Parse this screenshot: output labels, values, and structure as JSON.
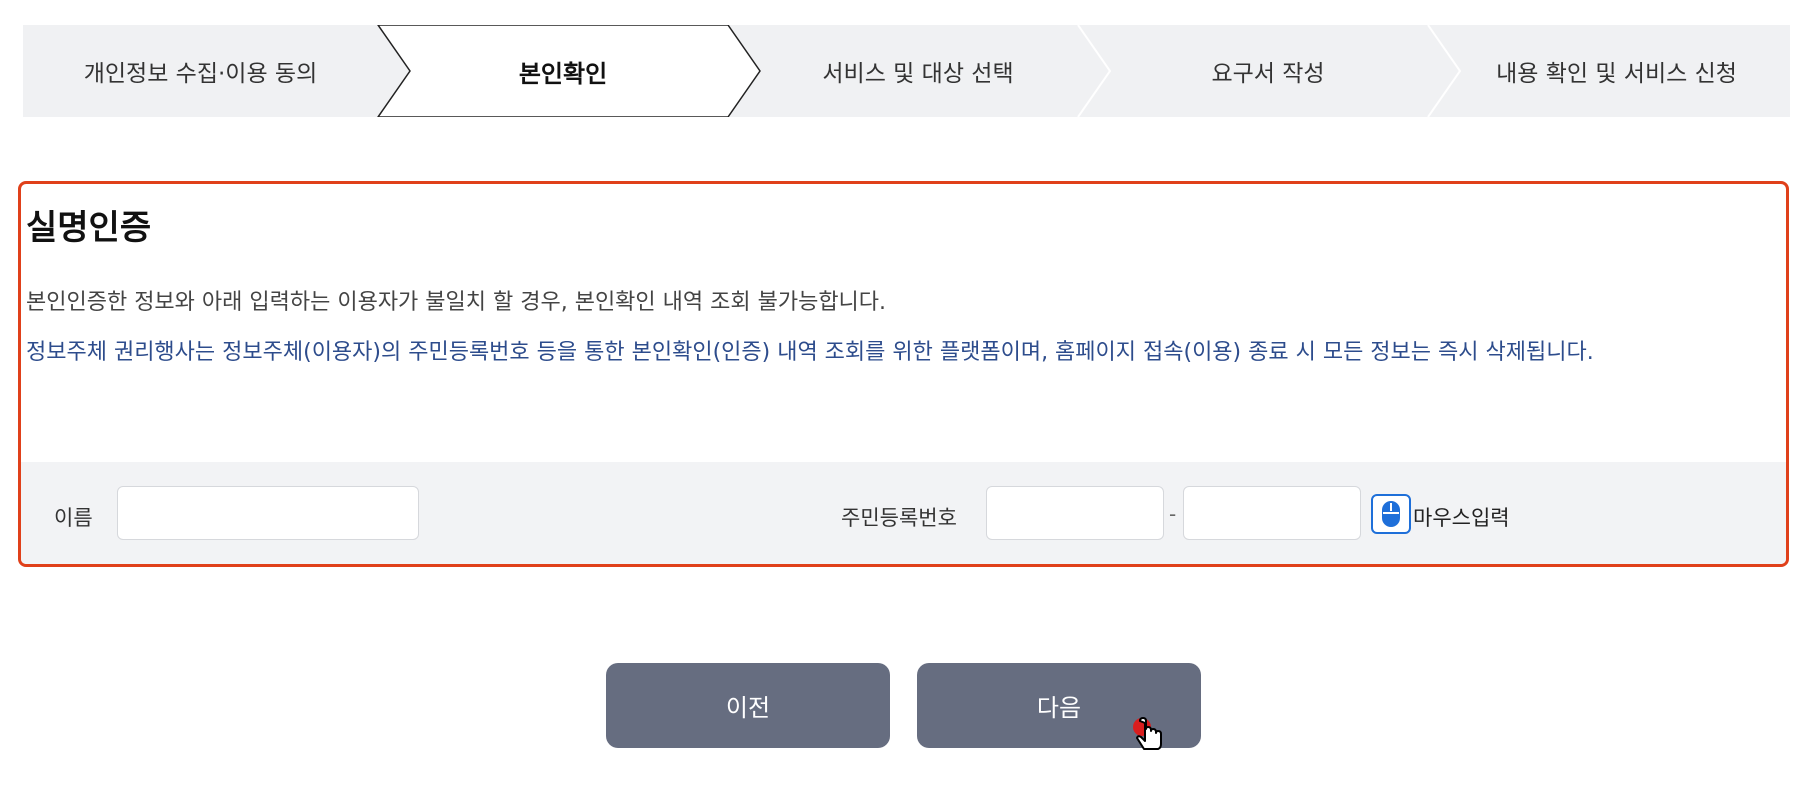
{
  "steps": [
    {
      "label": "개인정보 수집·이용 동의",
      "active": false
    },
    {
      "label": "본인확인",
      "active": true
    },
    {
      "label": "서비스 및 대상 선택",
      "active": false
    },
    {
      "label": "요구서 작성",
      "active": false
    },
    {
      "label": "내용 확인 및 서비스 신청",
      "active": false
    }
  ],
  "auth": {
    "title": "실명인증",
    "notice": "본인인증한 정보와 아래 입력하는 이용자가 불일치 할 경우, 본인확인 내역 조회 불가능합니다.",
    "info": "정보주체 권리행사는 정보주체(이용자)의 주민등록번호 등을 통한 본인확인(인증) 내역 조회를 위한 플랫폼이며, 홈페이지 접속(이용) 종료 시 모든 정보는 즉시 삭제됩니다.",
    "name_label": "이름",
    "name_value": "",
    "rrn_label": "주민등록번호",
    "rrn_front_value": "",
    "rrn_separator": "-",
    "rrn_back_value": "",
    "mouse_input_label": "마우스입력",
    "mouse_icon": "mouse-icon"
  },
  "buttons": {
    "prev_label": "이전",
    "next_label": "다음"
  },
  "colors": {
    "panel_border": "#e0401a",
    "info_text": "#2d4c8c",
    "button_bg": "#666d80",
    "stepper_bg": "#f0f1f3",
    "mouse_icon": "#1e6fd9"
  },
  "cursor": "hand-pointer-icon"
}
